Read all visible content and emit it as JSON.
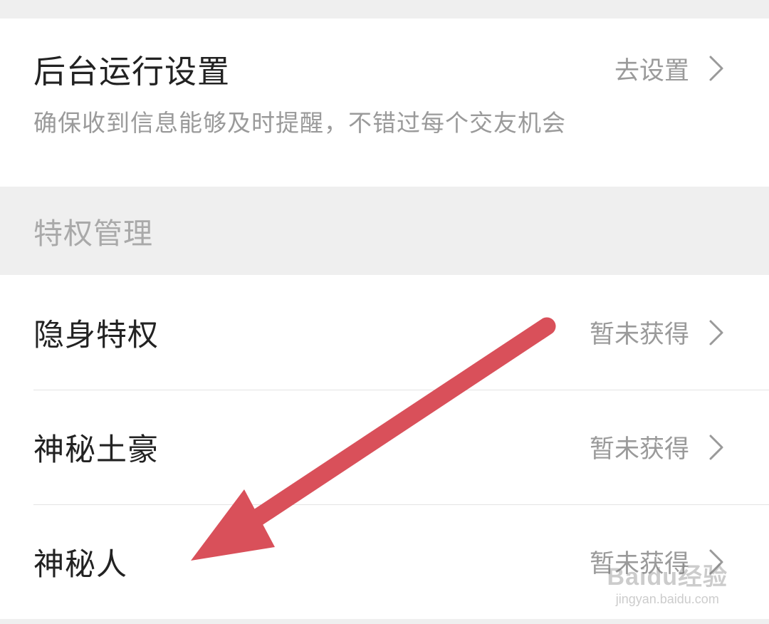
{
  "background_run": {
    "title": "后台运行设置",
    "action": "去设置",
    "description": "确保收到信息能够及时提醒，不错过每个交友机会"
  },
  "privileges": {
    "section_title": "特权管理",
    "items": [
      {
        "label": "隐身特权",
        "status": "暂未获得"
      },
      {
        "label": "神秘土豪",
        "status": "暂未获得"
      },
      {
        "label": "神秘人",
        "status": "暂未获得"
      }
    ]
  },
  "watermark": {
    "brand": "Baidu经验",
    "url": "jingyan.baidu.com"
  },
  "colors": {
    "arrow": "#d9505a",
    "background": "#efefef",
    "card": "#ffffff",
    "secondary_text": "#9a9a9a"
  }
}
